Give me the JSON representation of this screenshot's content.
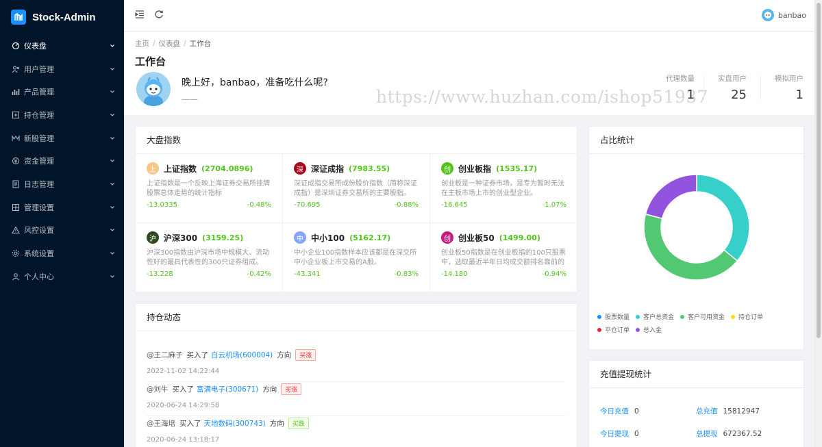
{
  "app": {
    "title": "Stock-Admin"
  },
  "sidebar": {
    "items": [
      {
        "label": "仪表盘",
        "icon": "dashboard-icon",
        "active": true
      },
      {
        "label": "用户管理",
        "icon": "users-icon"
      },
      {
        "label": "产品管理",
        "icon": "bar-chart-icon"
      },
      {
        "label": "持仓管理",
        "icon": "holdings-icon"
      },
      {
        "label": "新股管理",
        "icon": "new-stock-icon"
      },
      {
        "label": "资金管理",
        "icon": "money-icon"
      },
      {
        "label": "日志管理",
        "icon": "log-icon"
      },
      {
        "label": "管理设置",
        "icon": "grid-icon"
      },
      {
        "label": "风控设置",
        "icon": "warning-icon"
      },
      {
        "label": "系统设置",
        "icon": "gear-icon"
      },
      {
        "label": "个人中心",
        "icon": "user-icon"
      }
    ]
  },
  "header": {
    "username": "banbao"
  },
  "breadcrumb": [
    "主页",
    "仪表盘",
    "工作台"
  ],
  "page": {
    "title": "工作台",
    "greeting": "晚上好，banbao，准备吃什么呢?",
    "greeting_sub": "——",
    "watermark": "https://www.huzhan.com/ishop51937"
  },
  "stats": [
    {
      "label": "代理数量",
      "value": "1"
    },
    {
      "label": "实盘用户",
      "value": "25"
    },
    {
      "label": "模拟用户",
      "value": "1"
    }
  ],
  "market": {
    "title": "大盘指数",
    "indices": [
      {
        "badge": "上",
        "badge_color": "#f5c788",
        "name": "上证指数",
        "value": "(2704.0896)",
        "desc": "上证指数是一个反映上海证券交易所挂牌股票总体走势的统计指标",
        "change": "-13.0335",
        "pct": "-0.48%"
      },
      {
        "badge": "深",
        "badge_color": "#a8071a",
        "name": "深证成指",
        "value": "(7983.55)",
        "desc": "深证成指交易所成份股价指数（简称深证成指）是深圳证券交易所的主要股指。",
        "change": "-70.695",
        "pct": "-0.88%"
      },
      {
        "badge": "创",
        "badge_color": "#52c41a",
        "name": "创业板指",
        "value": "(1535.17)",
        "desc": "创业板是一种证券市场，是专为暂时无法在主板市场上市的创业型企业。",
        "change": "-16.645",
        "pct": "-1.07%"
      },
      {
        "badge": "沪",
        "badge_color": "#2d4a22",
        "name": "沪深300",
        "value": "(3159.25)",
        "desc": "沪深300指数由沪深市场中规模大、流动性好的最具代表性的300只证券组成。",
        "change": "-13.228",
        "pct": "-0.42%"
      },
      {
        "badge": "中",
        "badge_color": "#85a5ff",
        "name": "中小100",
        "value": "(5162.17)",
        "desc": "中小企业100指数样本应该都是在深交所中小企业板上市交易的A股。",
        "change": "-43.341",
        "pct": "-0.83%"
      },
      {
        "badge": "创",
        "badge_color": "#c41d7f",
        "name": "创业板50",
        "value": "(1499.00)",
        "desc": "创业板50指数是在创业板指的100只股票中，选取最近半年日均成交额排名靠前的",
        "change": "-14.180",
        "pct": "-0.94%"
      }
    ]
  },
  "holdings": {
    "title": "持仓动态",
    "items": [
      {
        "user": "@王二麻子",
        "action": "买入了",
        "stock": "白云机场(600004)",
        "direction_label": "方向",
        "tag": "买涨",
        "tag_type": "up",
        "time": "2022-11-02 14:22:44"
      },
      {
        "user": "@刘牛",
        "action": "买入了",
        "stock": "富满电子(300671)",
        "direction_label": "方向",
        "tag": "买涨",
        "tag_type": "up",
        "time": "2020-06-24 14:29:58"
      },
      {
        "user": "@王海培",
        "action": "买入了",
        "stock": "天地数码(300743)",
        "direction_label": "方向",
        "tag": "买跌",
        "tag_type": "down",
        "time": "2020-06-24 13:18:17"
      }
    ]
  },
  "ratio": {
    "title": "占比统计",
    "chart_data": {
      "type": "pie",
      "donut": true,
      "title": "",
      "series": [
        {
          "name": "股票数量",
          "value": 0,
          "color": "#1890ff"
        },
        {
          "name": "客户总资金",
          "value": 36,
          "color": "#36cfc9"
        },
        {
          "name": "客户可用资金",
          "value": 43,
          "color": "#52c873"
        },
        {
          "name": "持仓订单",
          "value": 0,
          "color": "#fadb14"
        },
        {
          "name": "平仓订单",
          "value": 0,
          "color": "#f5222d"
        },
        {
          "name": "总入金",
          "value": 21,
          "color": "#9254de"
        }
      ],
      "legend": "bottom"
    }
  },
  "recharge": {
    "title": "充值提现统计",
    "rows": [
      {
        "l1": "今日充值",
        "v1": "0",
        "l2": "总充值",
        "v2": "15812947"
      },
      {
        "l1": "今日提现",
        "v1": "0",
        "l2": "总提现",
        "v2": "672367.52"
      }
    ]
  }
}
